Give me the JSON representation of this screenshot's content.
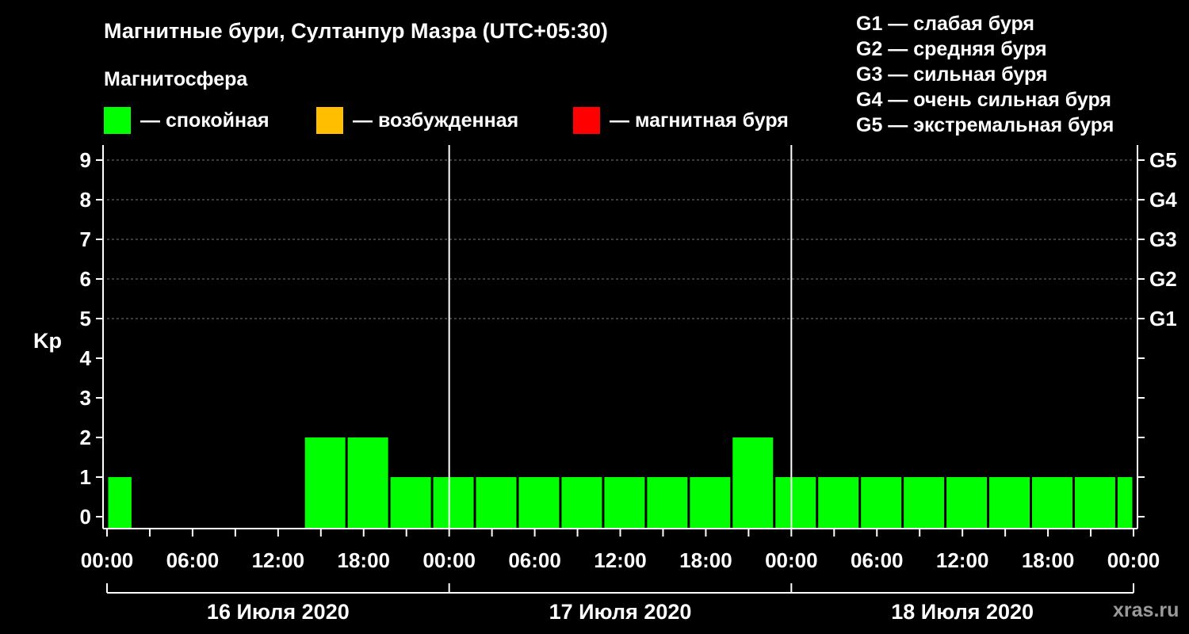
{
  "title": "Магнитные бури, Султанпур Мазра (UTC+05:30)",
  "subtitle": "Магнитосфера",
  "legend": [
    {
      "label": "— спокойная",
      "color": "#00ff00"
    },
    {
      "label": "— возбужденная",
      "color": "#ffbf00"
    },
    {
      "label": "— магнитная буря",
      "color": "#ff0000"
    }
  ],
  "g_legend": [
    "G1 — слабая буря",
    "G2 — средняя буря",
    "G3 — сильная буря",
    "G4 — очень сильная буря",
    "G5 — экстремальная буря"
  ],
  "watermark": "xras.ru",
  "chart_data": {
    "type": "bar",
    "ylabel": "Kp",
    "ylim": [
      0,
      9
    ],
    "yticks": [
      "0",
      "1",
      "2",
      "3",
      "4",
      "5",
      "6",
      "7",
      "8",
      "9"
    ],
    "right_labels": [
      {
        "kp": 5,
        "label": "G1"
      },
      {
        "kp": 6,
        "label": "G2"
      },
      {
        "kp": 7,
        "label": "G3"
      },
      {
        "kp": 8,
        "label": "G4"
      },
      {
        "kp": 9,
        "label": "G5"
      }
    ],
    "xlim_hours": [
      0,
      72
    ],
    "xticks": [
      {
        "h": 0,
        "label": "00:00"
      },
      {
        "h": 6,
        "label": "06:00"
      },
      {
        "h": 12,
        "label": "12:00"
      },
      {
        "h": 18,
        "label": "18:00"
      },
      {
        "h": 24,
        "label": "00:00"
      },
      {
        "h": 30,
        "label": "06:00"
      },
      {
        "h": 36,
        "label": "12:00"
      },
      {
        "h": 42,
        "label": "18:00"
      },
      {
        "h": 48,
        "label": "00:00"
      },
      {
        "h": 54,
        "label": "06:00"
      },
      {
        "h": 60,
        "label": "12:00"
      },
      {
        "h": 66,
        "label": "18:00"
      },
      {
        "h": 72,
        "label": "00:00"
      }
    ],
    "days": [
      {
        "label": "16 Июля 2020",
        "start": 0,
        "end": 24
      },
      {
        "label": "17 Июля 2020",
        "start": 24,
        "end": 48
      },
      {
        "label": "18 Июля 2020",
        "start": 48,
        "end": 72
      }
    ],
    "color": "#00ff00",
    "grid": true,
    "bars": [
      {
        "start": 0,
        "end": 1.8,
        "kp": 1
      },
      {
        "start": 1.8,
        "end": 4.8,
        "kp": 0
      },
      {
        "start": 4.8,
        "end": 7.8,
        "kp": 0
      },
      {
        "start": 7.8,
        "end": 10.8,
        "kp": 0
      },
      {
        "start": 10.8,
        "end": 13.8,
        "kp": 0
      },
      {
        "start": 13.8,
        "end": 16.8,
        "kp": 2
      },
      {
        "start": 16.8,
        "end": 19.8,
        "kp": 2
      },
      {
        "start": 19.8,
        "end": 22.8,
        "kp": 1
      },
      {
        "start": 22.8,
        "end": 25.8,
        "kp": 1
      },
      {
        "start": 25.8,
        "end": 28.8,
        "kp": 1
      },
      {
        "start": 28.8,
        "end": 31.8,
        "kp": 1
      },
      {
        "start": 31.8,
        "end": 34.8,
        "kp": 1
      },
      {
        "start": 34.8,
        "end": 37.8,
        "kp": 1
      },
      {
        "start": 37.8,
        "end": 40.8,
        "kp": 1
      },
      {
        "start": 40.8,
        "end": 43.8,
        "kp": 1
      },
      {
        "start": 43.8,
        "end": 46.8,
        "kp": 2
      },
      {
        "start": 46.8,
        "end": 49.8,
        "kp": 1
      },
      {
        "start": 49.8,
        "end": 52.8,
        "kp": 1
      },
      {
        "start": 52.8,
        "end": 55.8,
        "kp": 1
      },
      {
        "start": 55.8,
        "end": 58.8,
        "kp": 1
      },
      {
        "start": 58.8,
        "end": 61.8,
        "kp": 1
      },
      {
        "start": 61.8,
        "end": 64.8,
        "kp": 1
      },
      {
        "start": 64.8,
        "end": 67.8,
        "kp": 1
      },
      {
        "start": 67.8,
        "end": 70.8,
        "kp": 1
      },
      {
        "start": 70.8,
        "end": 72,
        "kp": 1
      }
    ]
  }
}
